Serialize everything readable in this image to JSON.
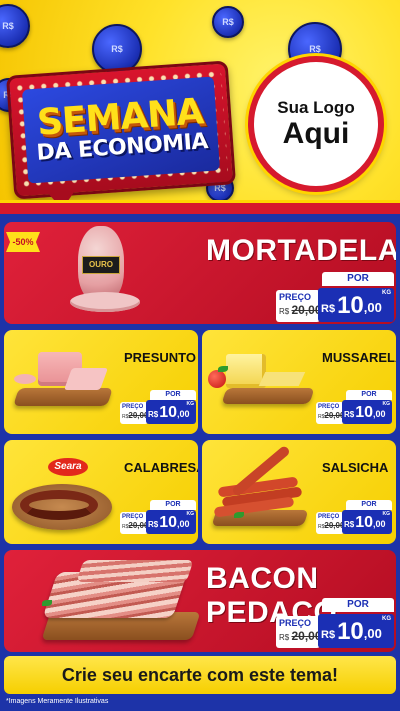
{
  "header": {
    "title_line1": "SEMANA",
    "title_line2": "DA ECONOMIA",
    "coin_label": "R$",
    "logo_line1": "Sua Logo",
    "logo_line2": "Aqui"
  },
  "discount_badge": "-50%",
  "price_labels": {
    "preco": "PREÇO",
    "por": "POR",
    "rs": "R$",
    "kg": "KG",
    "old_prefix": "R$"
  },
  "products": {
    "mortadela": {
      "name": "MORTADELA",
      "brand": "OURO",
      "old_price": "20,00",
      "price_int": "10",
      "price_dec": ",00"
    },
    "presunto": {
      "name": "PRESUNTO",
      "old_price": "20,00",
      "price_int": "10",
      "price_dec": ",00"
    },
    "mussarela": {
      "name": "MUSSARELA",
      "old_price": "20,00",
      "price_int": "10",
      "price_dec": ",00"
    },
    "calabresa": {
      "name": "CALABRESA",
      "brand": "Seara",
      "old_price": "20,00",
      "price_int": "10",
      "price_dec": ",00"
    },
    "salsicha": {
      "name": "SALSICHA",
      "old_price": "20,00",
      "price_int": "10",
      "price_dec": ",00"
    },
    "bacon": {
      "name": "BACON PEDAÇO",
      "old_price": "20,00",
      "price_int": "10",
      "price_dec": ",00"
    }
  },
  "cta": "Crie seu encarte com este tema!",
  "disclaimer": "*Imagens Meramente Ilustrativas",
  "colors": {
    "red": "#d6182c",
    "yellow": "#ffe01a",
    "blue": "#1b2fb4"
  }
}
